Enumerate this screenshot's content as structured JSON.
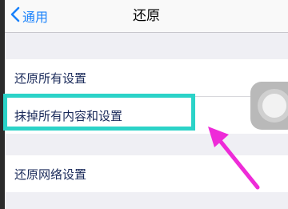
{
  "nav": {
    "back_label": "通用",
    "title": "还原"
  },
  "settings": {
    "items": [
      {
        "label": "还原所有设置"
      },
      {
        "label": "抹掉所有内容和设置"
      },
      {
        "label": "还原网络设置"
      }
    ]
  },
  "colors": {
    "accent": "#1a82fb",
    "highlight_box": "#2bd3c8",
    "arrow": "#ee2bd8"
  },
  "icons": {
    "back": "chevron-left-icon",
    "assistive_touch": "assistive-touch-icon"
  }
}
